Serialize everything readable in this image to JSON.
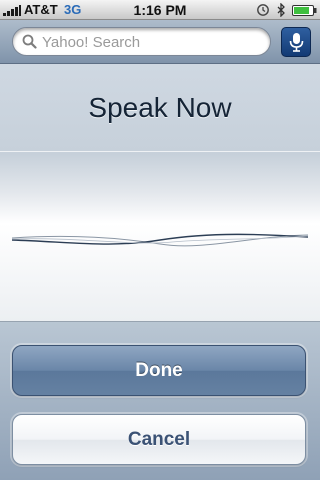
{
  "status_bar": {
    "carrier": "AT&T",
    "network": "3G",
    "time": "1:16 PM",
    "signal_bars": 5,
    "battery_level": 0.8,
    "icons": [
      "signal-icon",
      "lock-icon",
      "bluetooth-icon",
      "battery-icon"
    ]
  },
  "search": {
    "placeholder": "Yahoo! Search",
    "value": "",
    "icon": "search-icon",
    "voice_button_icon": "microphone-icon"
  },
  "speak": {
    "title": "Speak Now",
    "waveform_icon": "waveform-icon"
  },
  "buttons": {
    "done_label": "Done",
    "cancel_label": "Cancel"
  },
  "colors": {
    "accent": "#123a74",
    "done_button": "#6a86a8",
    "cancel_text": "#3b5275",
    "network": "#2a6bb8"
  }
}
